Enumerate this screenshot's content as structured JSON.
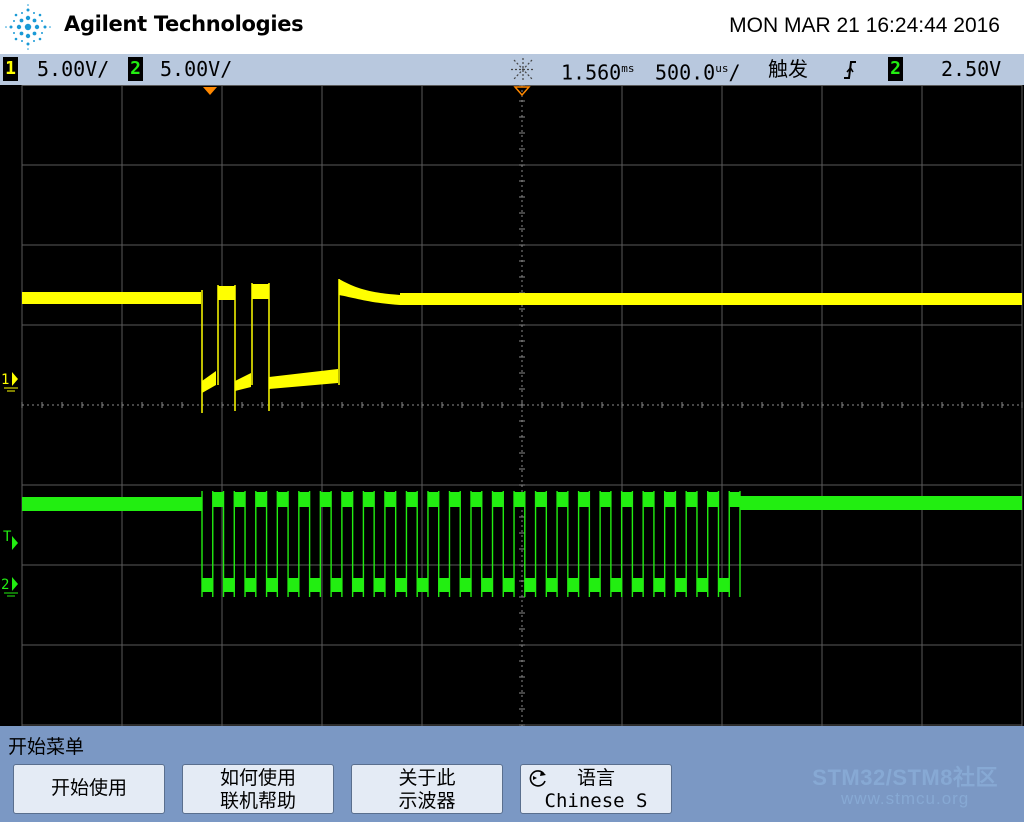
{
  "header": {
    "brand": "Agilent Technologies",
    "datetime": "MON MAR 21 16:24:44 2016"
  },
  "status": {
    "ch1_number": "1",
    "ch1_scale": "5.00V/",
    "ch2_number": "2",
    "ch2_scale": "5.00V/",
    "delay": "1.560",
    "delay_unit": "ms",
    "timebase": "500.0",
    "timebase_unit": "us",
    "trigger_label": "触发",
    "trigger_slope_icon": "rising-edge-icon",
    "trigger_source": "2",
    "trigger_level": "2.50V"
  },
  "screen": {
    "ch1_marker": "1",
    "trigger_marker": "T",
    "ch2_marker": "2",
    "colors": {
      "ch1": "#ffff00",
      "ch2": "#22ee11",
      "grid": "#5a5a5a"
    }
  },
  "menu": {
    "title": "开始菜单",
    "softkeys": [
      {
        "line1": "开始使用",
        "line2": ""
      },
      {
        "line1": "如何使用",
        "line2": "联机帮助"
      },
      {
        "line1": "关于此",
        "line2": "示波器"
      },
      {
        "line1": "语言",
        "line2": "Chinese S",
        "icon": "rotate-knob-icon"
      }
    ]
  },
  "watermark": {
    "main": "STM32/STM8社区",
    "url": "www.stmcu.org"
  }
}
